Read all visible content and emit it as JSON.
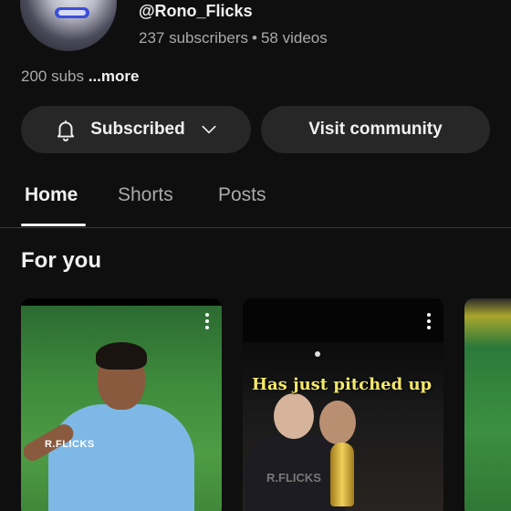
{
  "channel": {
    "handle": "@Rono_Flicks",
    "subscribers": "237 subscribers",
    "separator": "•",
    "videos": "58 videos",
    "description": "200 subs",
    "more_label": "...more"
  },
  "actions": {
    "subscribed_label": "Subscribed",
    "community_label": "Visit community"
  },
  "tabs": [
    {
      "label": "Home",
      "active": true
    },
    {
      "label": "Shorts",
      "active": false
    },
    {
      "label": "Posts",
      "active": false
    }
  ],
  "section": {
    "title": "For you"
  },
  "videos": [
    {
      "watermark": "R.FLICKS",
      "caption": ""
    },
    {
      "watermark": "R.FLICKS",
      "caption": "Has just pitched up"
    },
    {
      "watermark": "",
      "caption": ""
    }
  ],
  "colors": {
    "background": "#0f0f0f",
    "button_bg": "#272727",
    "text_primary": "#f1f1f1",
    "text_secondary": "#aaaaaa",
    "caption_yellow": "#f3e86a"
  },
  "icons": {
    "bell": "bell-icon",
    "chevron": "chevron-down-icon",
    "menu": "more-vert-icon"
  }
}
